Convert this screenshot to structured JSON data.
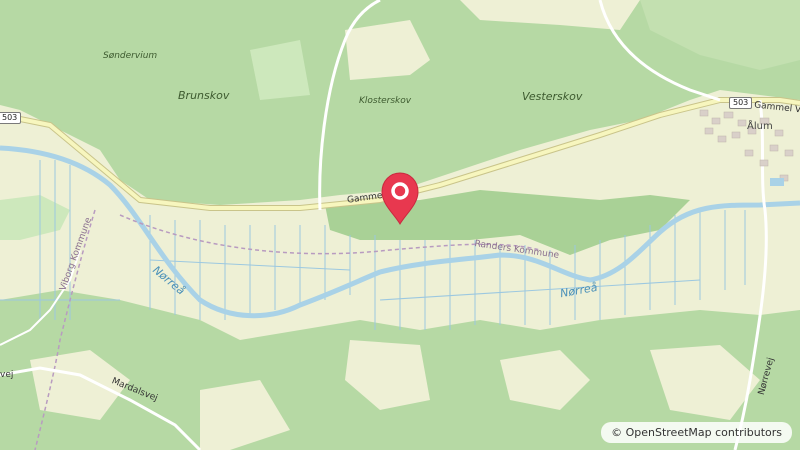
{
  "map": {
    "attribution": "© OpenStreetMap contributors",
    "marker_icon": "map-pin-icon",
    "colors": {
      "forest": "#b6d9a4",
      "forest_dark": "#a9d196",
      "farmland": "#eef0d5",
      "water": "#a9d2e7",
      "road_primary": "#f7f6be",
      "road_secondary": "#ffffff",
      "marker": "#e8384f"
    },
    "labels": {
      "sondervium": "Søndervium",
      "brunskov": "Brunskov",
      "klosterskov": "Klosterskov",
      "vesterskov": "Vesterskov",
      "alum": "Ålum",
      "gammel_vej_east": "Gammel Vi",
      "gammel_vej_mid": "Gammel Vej",
      "viborg_kommune": "Viborg Kommune",
      "randers_kommune": "Randers Kommune",
      "norrea_west": "Nørreå",
      "norrea_east": "Nørreå",
      "mardalsvej": "Mardalsvej",
      "norrevej": "Nørrevej",
      "vej_west": "vej"
    },
    "shields": {
      "route_west": "503",
      "route_east": "503"
    }
  }
}
